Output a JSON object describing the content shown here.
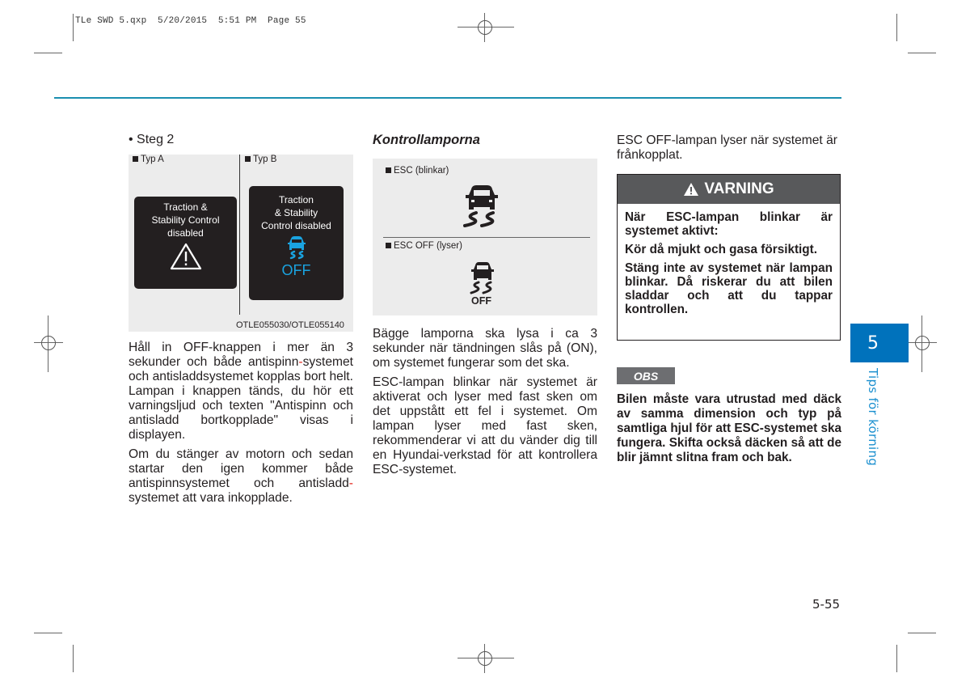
{
  "slug": "TLe SWD 5.qxp  5/20/2015  5:51 PM  Page 55",
  "colors": {
    "accent_line": "#1a8fb0",
    "chapter_blue": "#0072bc",
    "warning_header": "#58595b",
    "obs_badge": "#6d6e71",
    "esc_off_blue": "#1aa3e0",
    "hyphen_red": "#e2231a"
  },
  "column1": {
    "step_label": "• Steg 2",
    "figure": {
      "type_a_label": "Typ A",
      "type_b_label": "Typ B",
      "panel_a_lines": [
        "Traction &",
        "Stability Control",
        "disabled"
      ],
      "panel_a_icon": "warning-triangle-icon",
      "panel_b_lines": [
        "Traction",
        "& Stability",
        "Control disabled"
      ],
      "panel_b_icon": "esc-off-icon",
      "panel_b_off_text": "OFF",
      "figure_code": "OTLE055030/OTLE055140"
    },
    "para1": {
      "l1": "Håll in OFF-knappen i mer än 3",
      "l2a": "sekunder och både antispinn",
      "l2b": "-",
      "l3": "systemet och antisladdsystemet",
      "l4": "kopplas bort helt. Lampan i knappen",
      "l5": "tänds, du hör ett varningsljud och",
      "l6": "texten \"Antispinn och antisladd",
      "l7": "bortkopplade\" visas i displayen."
    },
    "para2": {
      "l1": "Om du stänger av motorn och sedan",
      "l2": "startar den igen kommer  både",
      "l3a": "antispinnsystemet och antisladd",
      "l3b": "-",
      "l4": "systemet att vara inkopplade."
    }
  },
  "column2": {
    "heading": "Kontrollamporna",
    "lamps": [
      {
        "label": "ESC (blinkar)",
        "icon": "esc-indicator-icon"
      },
      {
        "label": "ESC OFF (lyser)",
        "icon": "esc-off-indicator-icon",
        "off_text": "OFF"
      }
    ],
    "para1": "Bägge lamporna ska lysa i ca 3 sekunder när tändningen slås på (ON), om systemet fungerar som det ska.",
    "para2": "ESC-lampan blinkar när systemet är aktiverat och lyser med fast sken om det uppstått ett fel i systemet. Om lampan lyser med fast sken, rekommenderar vi att du vänder dig till en Hyundai-verkstad för att kontrollera ESC-systemet."
  },
  "column3": {
    "intro": "ESC OFF-lampan lyser när systemet är frånkopplat.",
    "warning": {
      "title": "VARNING",
      "icon": "warning-triangle-icon",
      "p1": "När ESC-lampan blinkar är systemet aktivt:",
      "p2": "Kör då mjukt och gasa försiktigt.",
      "p3": "Stäng inte av systemet när lampan blinkar. Då riskerar du att bilen sladdar och att du tappar kontrollen."
    },
    "obs": {
      "badge": "OBS",
      "text": "Bilen måste vara utrustad med däck av samma dimension och typ på samtliga hjul för att ESC-systemet ska fungera. Skifta också däcken så att de blir jämnt slitna fram och bak."
    }
  },
  "chapter": {
    "number": "5",
    "title": "Tips för körning"
  },
  "page_number": "5-55"
}
